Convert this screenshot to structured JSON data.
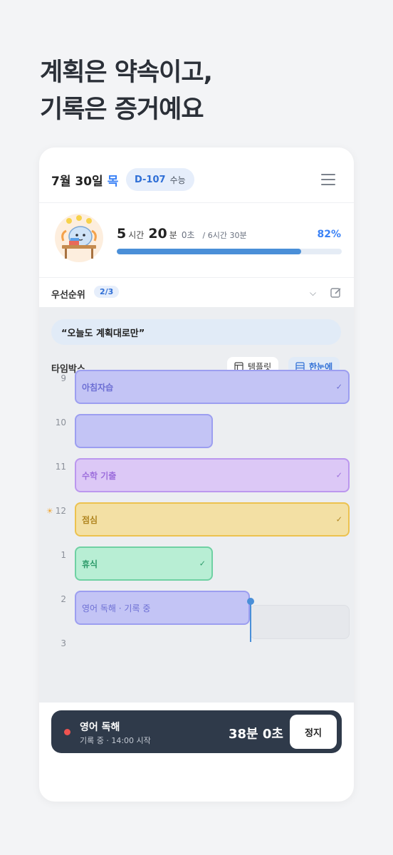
{
  "headline": {
    "line1": "계획은 약속이고,",
    "line2": "기록은 증거예요"
  },
  "header": {
    "date": "7월 30일",
    "weekday": "목",
    "dday": "D-107",
    "exam": "수능"
  },
  "stats": {
    "hours": "5",
    "hours_unit": "시간",
    "minutes": "20",
    "minutes_unit": "분",
    "seconds": "0초",
    "goal": "/ 6시간 30분",
    "percent_label": "82%",
    "progress": 0.82
  },
  "priority": {
    "label": "우선순위",
    "count": "2/3"
  },
  "quote": "“오늘도 계획대로만”",
  "timebox": {
    "title": "타임박스",
    "template_label": "템플릿",
    "glance_label": "한눈에",
    "hours": [
      "9",
      "10",
      "11",
      "12",
      "1",
      "2",
      "3"
    ],
    "blocks": [
      {
        "label": "아침자습",
        "checked": true
      },
      {
        "label": "",
        "checked": false
      },
      {
        "label": "수학 기출",
        "checked": true
      },
      {
        "label": "점심",
        "checked": true
      },
      {
        "label": "휴식",
        "checked": true
      },
      {
        "label": "영어 독해 · 기록 중",
        "checked": false
      }
    ]
  },
  "timer": {
    "task": "영어 독해",
    "status": "기록 중 · 14:00 시작",
    "elapsed": "38분 0초",
    "stop_label": "정지"
  },
  "colors": {
    "accent": "#3b82f6",
    "timer_bg": "#2f3a4a",
    "recording": "#ef5350"
  }
}
